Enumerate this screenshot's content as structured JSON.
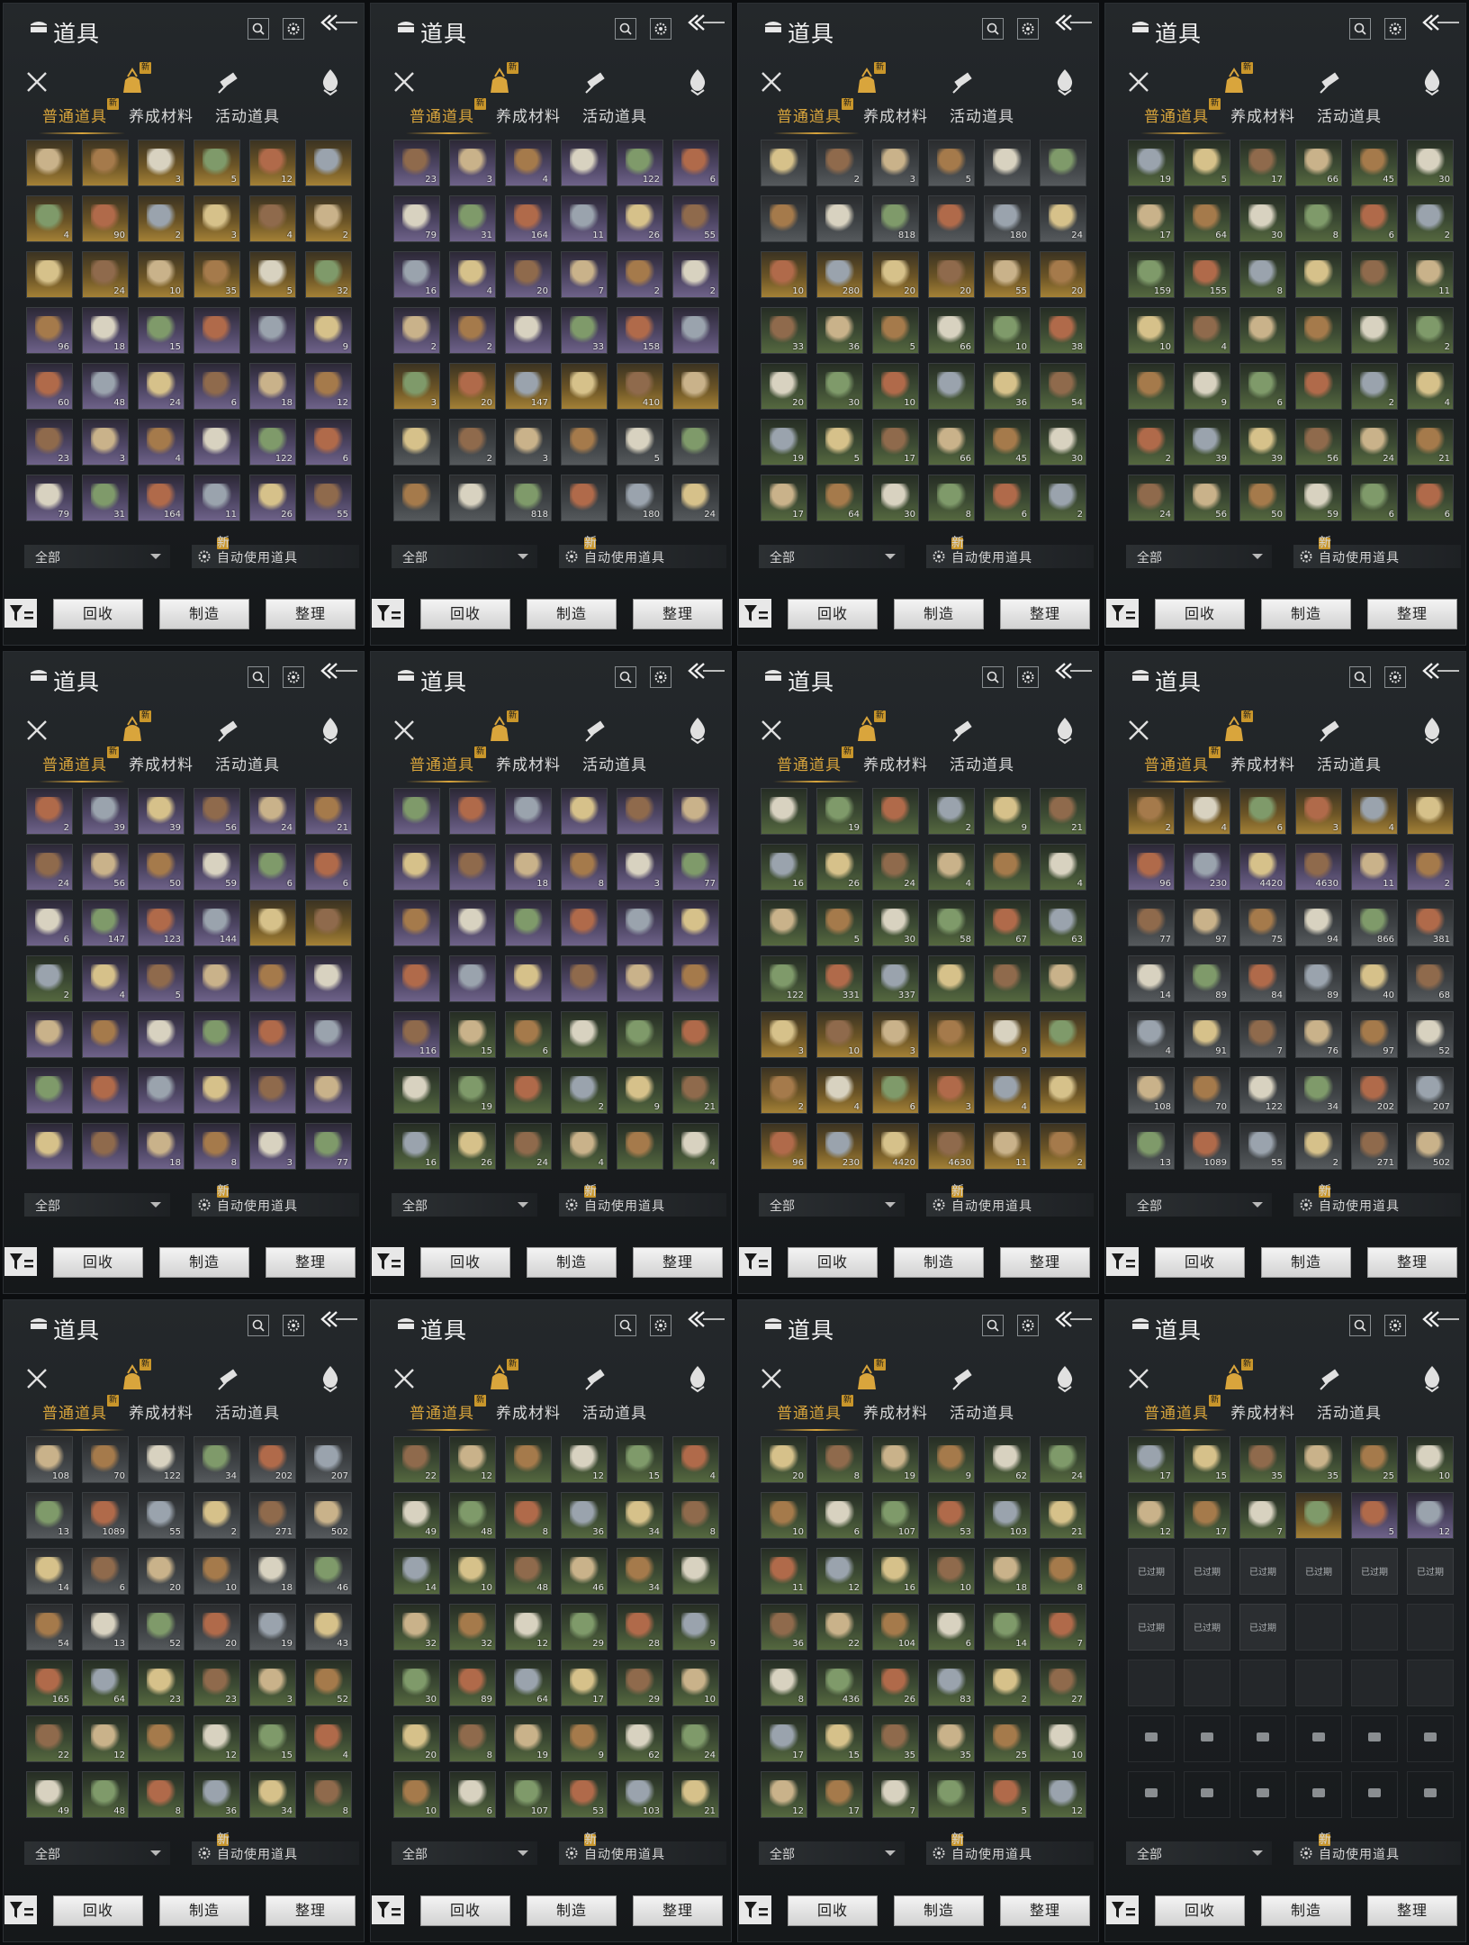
{
  "panel_common": {
    "title": "道具",
    "tabs": [
      "普通道具",
      "养成材料",
      "活动道具"
    ],
    "category_icons": [
      "crossed-swords-icon",
      "pouch-icon",
      "scroll-icon",
      "gem-drop-icon"
    ],
    "new_badge": "新",
    "filter_dropdown": "全部",
    "auto_use": "自动使用道具",
    "buttons": [
      "回收",
      "制造",
      "整理"
    ],
    "expired_label": "已过期"
  },
  "panels": [
    {
      "rows": [
        [
          "gold:",
          "gold:",
          "gold:3",
          "gold:5",
          "gold:12",
          "gold:"
        ],
        [
          "gold:4",
          "gold:90",
          "gold:2",
          "gold:3",
          "gold:4",
          "gold:2"
        ],
        [
          "gold:",
          "gold:24",
          "gold:10",
          "gold:35",
          "gold:5",
          "gold:32"
        ],
        [
          "purple:96",
          "purple:18",
          "purple:15",
          "purple:",
          "purple:",
          "purple:9"
        ],
        [
          "purple:60",
          "purple:48",
          "purple:24",
          "purple:6",
          "purple:18",
          "purple:12"
        ],
        [
          "purple:23",
          "purple:3",
          "purple:4",
          "purple:",
          "purple:122",
          "purple:6"
        ],
        [
          "purple:79",
          "purple:31",
          "purple:164",
          "purple:11",
          "purple:26",
          "purple:55"
        ]
      ]
    },
    {
      "rows": [
        [
          "purple:23",
          "purple:3",
          "purple:4",
          "purple:",
          "purple:122",
          "purple:6"
        ],
        [
          "purple:79",
          "purple:31",
          "purple:164",
          "purple:11",
          "purple:26",
          "purple:55"
        ],
        [
          "purple:16",
          "purple:4",
          "purple:20",
          "purple:7",
          "purple:2",
          "purple:2"
        ],
        [
          "purple:2",
          "purple:2",
          "purple:",
          "purple:33",
          "purple:158",
          "purple:"
        ],
        [
          "gold:3",
          "gold:20",
          "gold:147",
          "gold:",
          "gold:410",
          "gold:"
        ],
        [
          "gray:",
          "gray:2",
          "gray:3",
          "gray:",
          "gray:5",
          "gray:"
        ],
        [
          "gray:",
          "gray:",
          "gray:818",
          "gray:",
          "gray:180",
          "gray:24"
        ]
      ]
    },
    {
      "rows": [
        [
          "gray:",
          "gray:2",
          "gray:3",
          "gray:5",
          "gray:",
          "gray:"
        ],
        [
          "gray:",
          "gray:",
          "gray:818",
          "gray:",
          "gray:180",
          "gray:24"
        ],
        [
          "gold:10",
          "gold:280",
          "gold:20",
          "gold:20",
          "gold:55",
          "gold:20"
        ],
        [
          "green:33",
          "green:36",
          "green:5",
          "green:66",
          "green:10",
          "green:38"
        ],
        [
          "green:20",
          "green:30",
          "green:10",
          "green:",
          "green:36",
          "green:54"
        ],
        [
          "green:19",
          "green:5",
          "green:17",
          "green:66",
          "green:45",
          "green:30"
        ],
        [
          "green:17",
          "green:64",
          "green:30",
          "green:8",
          "green:6",
          "green:2"
        ]
      ]
    },
    {
      "rows": [
        [
          "green:19",
          "green:5",
          "green:17",
          "green:66",
          "green:45",
          "green:30"
        ],
        [
          "green:17",
          "green:64",
          "green:30",
          "green:8",
          "green:6",
          "green:2"
        ],
        [
          "green:159",
          "green:155",
          "green:8",
          "green:",
          "green:",
          "green:11"
        ],
        [
          "green:10",
          "green:4",
          "green:",
          "green:",
          "green:",
          "green:2"
        ],
        [
          "green:",
          "green:9",
          "green:6",
          "green:",
          "green:2",
          "green:4"
        ],
        [
          "green:2",
          "green:39",
          "green:39",
          "green:56",
          "green:24",
          "green:21"
        ],
        [
          "green:24",
          "green:56",
          "green:50",
          "green:59",
          "green:6",
          "green:6"
        ]
      ]
    },
    {
      "rows": [
        [
          "purple:2",
          "purple:39",
          "purple:39",
          "purple:56",
          "purple:24",
          "purple:21"
        ],
        [
          "purple:24",
          "purple:56",
          "purple:50",
          "purple:59",
          "purple:6",
          "purple:6"
        ],
        [
          "purple:6",
          "purple:147",
          "purple:123",
          "purple:144",
          "gold:",
          "gold:"
        ],
        [
          "green:2",
          "purple:4",
          "purple:5",
          "purple:",
          "purple:",
          "purple:"
        ],
        [
          "purple:",
          "purple:",
          "purple:",
          "purple:",
          "purple:",
          "purple:"
        ],
        [
          "purple:",
          "purple:",
          "purple:",
          "purple:",
          "purple:",
          "purple:"
        ],
        [
          "purple:",
          "purple:",
          "purple:18",
          "purple:8",
          "purple:3",
          "purple:77"
        ]
      ]
    },
    {
      "rows": [
        [
          "purple:",
          "purple:",
          "purple:",
          "purple:",
          "purple:",
          "purple:"
        ],
        [
          "purple:",
          "purple:",
          "purple:18",
          "purple:8",
          "purple:3",
          "purple:77"
        ],
        [
          "purple:",
          "purple:",
          "purple:",
          "purple:",
          "purple:",
          "purple:"
        ],
        [
          "purple:",
          "purple:",
          "purple:",
          "purple:",
          "purple:",
          "purple:"
        ],
        [
          "purple:116",
          "green:15",
          "green:6",
          "green:",
          "green:",
          "green:"
        ],
        [
          "green:",
          "green:19",
          "green:",
          "green:2",
          "green:9",
          "green:21"
        ],
        [
          "green:16",
          "green:26",
          "green:24",
          "green:4",
          "green:",
          "green:4"
        ]
      ]
    },
    {
      "rows": [
        [
          "green:",
          "green:19",
          "green:",
          "green:2",
          "green:9",
          "green:21"
        ],
        [
          "green:16",
          "green:26",
          "green:24",
          "green:4",
          "green:",
          "green:4"
        ],
        [
          "green:",
          "green:5",
          "green:30",
          "green:58",
          "green:67",
          "green:63"
        ],
        [
          "green:122",
          "green:331",
          "green:337",
          "green:",
          "green:",
          "green:"
        ],
        [
          "gold:3",
          "gold:10",
          "gold:3",
          "gold:",
          "gold:9",
          "gold:"
        ],
        [
          "gold:2",
          "gold:4",
          "gold:6",
          "gold:3",
          "gold:4",
          "gold:"
        ],
        [
          "gold:96",
          "gold:230",
          "gold:4420",
          "gold:4630",
          "gold:11",
          "gold:2"
        ]
      ]
    },
    {
      "rows": [
        [
          "gold:2",
          "gold:4",
          "gold:6",
          "gold:3",
          "gold:4",
          "gold:"
        ],
        [
          "purple:96",
          "purple:230",
          "purple:4420",
          "purple:4630",
          "purple:11",
          "purple:2"
        ],
        [
          "gray:77",
          "gray:97",
          "gray:75",
          "gray:94",
          "gray:866",
          "gray:381"
        ],
        [
          "gray:14",
          "gray:89",
          "gray:84",
          "gray:89",
          "gray:40",
          "gray:68"
        ],
        [
          "gray:4",
          "gray:91",
          "gray:7",
          "gray:76",
          "gray:97",
          "gray:52"
        ],
        [
          "gray:108",
          "gray:70",
          "gray:122",
          "gray:34",
          "gray:202",
          "gray:207"
        ],
        [
          "gray:13",
          "gray:1089",
          "gray:55",
          "gray:2",
          "gray:271",
          "gray:502"
        ]
      ]
    },
    {
      "rows": [
        [
          "gray:108",
          "gray:70",
          "gray:122",
          "gray:34",
          "gray:202",
          "gray:207"
        ],
        [
          "gray:13",
          "gray:1089",
          "gray:55",
          "gray:2",
          "gray:271",
          "gray:502"
        ],
        [
          "gray:14",
          "gray:6",
          "gray:20",
          "gray:10",
          "gray:18",
          "gray:46"
        ],
        [
          "gray:54",
          "gray:13",
          "gray:52",
          "gray:20",
          "gray:19",
          "gray:43"
        ],
        [
          "green:165",
          "green:64",
          "green:23",
          "green:23",
          "green:3",
          "green:52"
        ],
        [
          "green:22",
          "green:12",
          "green:",
          "green:12",
          "green:15",
          "green:4"
        ],
        [
          "green:49",
          "green:48",
          "green:8",
          "green:36",
          "green:34",
          "green:8"
        ]
      ]
    },
    {
      "rows": [
        [
          "green:22",
          "green:12",
          "green:",
          "green:12",
          "green:15",
          "green:4"
        ],
        [
          "green:49",
          "green:48",
          "green:8",
          "green:36",
          "green:34",
          "green:8"
        ],
        [
          "green:14",
          "green:10",
          "green:48",
          "green:46",
          "green:34",
          "green:"
        ],
        [
          "green:32",
          "green:32",
          "green:12",
          "green:29",
          "green:28",
          "green:9"
        ],
        [
          "green:30",
          "green:89",
          "green:64",
          "green:17",
          "green:29",
          "green:10"
        ],
        [
          "green:20",
          "green:8",
          "green:19",
          "green:9",
          "green:62",
          "green:24"
        ],
        [
          "green:10",
          "green:6",
          "green:107",
          "green:53",
          "green:103",
          "green:21"
        ]
      ]
    },
    {
      "rows": [
        [
          "green:20",
          "green:8",
          "green:19",
          "green:9",
          "green:62",
          "green:24"
        ],
        [
          "green:10",
          "green:6",
          "green:107",
          "green:53",
          "green:103",
          "green:21"
        ],
        [
          "green:11",
          "green:12",
          "green:16",
          "green:10",
          "green:18",
          "green:8"
        ],
        [
          "green:36",
          "green:22",
          "green:104",
          "green:6",
          "green:14",
          "green:7"
        ],
        [
          "green:8",
          "green:436",
          "green:26",
          "green:83",
          "green:2",
          "green:27"
        ],
        [
          "green:17",
          "green:15",
          "green:35",
          "green:35",
          "green:25",
          "green:10"
        ],
        [
          "green:12",
          "green:17",
          "green:7",
          "green:",
          "green:5",
          "green:12"
        ]
      ]
    },
    {
      "rows": [
        [
          "green:17",
          "green:15",
          "green:35",
          "green:35",
          "green:25",
          "green:10"
        ],
        [
          "green:12",
          "green:17",
          "green:7",
          "gold:",
          "purple:5",
          "purple:12"
        ],
        [
          "expired:",
          "expired:",
          "expired:",
          "expired:",
          "expired:",
          "expired:"
        ],
        [
          "expired:",
          "expired:",
          "expired:",
          "empty:",
          "empty:",
          "empty:"
        ],
        [
          "empty:",
          "empty:",
          "empty:",
          "empty:",
          "empty:",
          "empty:"
        ],
        [
          "lock:",
          "lock:",
          "lock:",
          "lock:",
          "lock:",
          "lock:"
        ],
        [
          "lock:",
          "lock:",
          "lock:",
          "lock:",
          "lock:",
          "lock:"
        ]
      ]
    }
  ],
  "colors": {
    "accent_gold": "#d9a53c",
    "panel_bg": "#1b1e21",
    "button_bg": "#e8e8e8"
  }
}
